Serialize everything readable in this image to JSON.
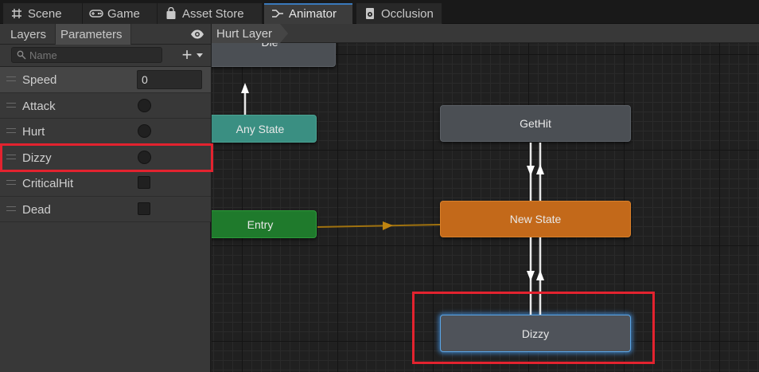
{
  "tabs": [
    {
      "label": "Scene",
      "icon": "grid-icon"
    },
    {
      "label": "Game",
      "icon": "gamepad-icon"
    },
    {
      "label": "Asset Store",
      "icon": "bag-icon"
    },
    {
      "label": "Animator",
      "icon": "animator-icon",
      "active": true
    },
    {
      "label": "Occlusion",
      "icon": "occlusion-icon"
    }
  ],
  "panel": {
    "tabs": [
      "Layers",
      "Parameters"
    ],
    "active_tab": "Parameters",
    "search_placeholder": "Name",
    "add_label": "+"
  },
  "parameters": [
    {
      "name": "Speed",
      "type": "float",
      "value": "0"
    },
    {
      "name": "Attack",
      "type": "trigger"
    },
    {
      "name": "Hurt",
      "type": "trigger"
    },
    {
      "name": "Dizzy",
      "type": "trigger",
      "highlighted": true
    },
    {
      "name": "CriticalHit",
      "type": "bool"
    },
    {
      "name": "Dead",
      "type": "bool"
    }
  ],
  "graph": {
    "breadcrumb": "Hurt Layer",
    "nodes": {
      "die": "Die",
      "any_state": "Any State",
      "entry": "Entry",
      "get_hit": "GetHit",
      "new_state": "New State",
      "dizzy": "Dizzy"
    }
  },
  "colors": {
    "highlight": "#e3232f",
    "default_state": "#c3691a",
    "entry": "#1f7a2c",
    "any_state": "#3a8f82",
    "selected_glow": "#5aa5e6"
  }
}
